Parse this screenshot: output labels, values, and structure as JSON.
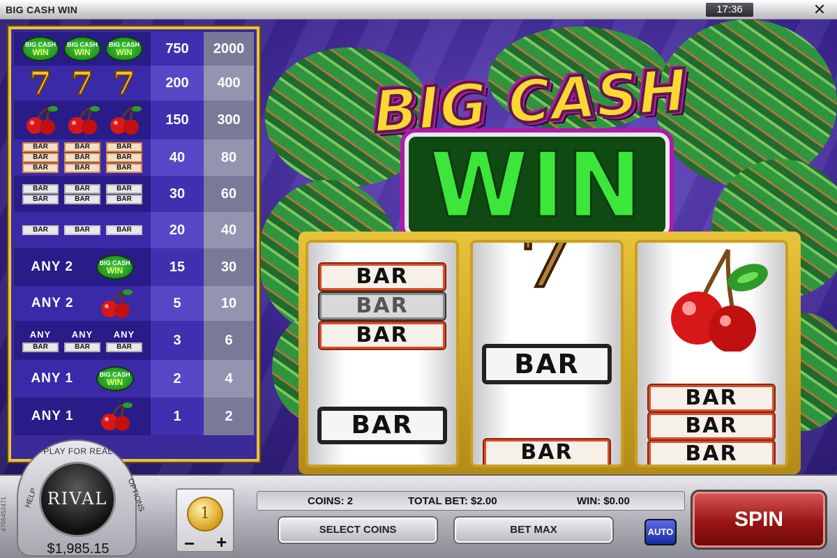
{
  "window": {
    "title": "BIG CASH WIN",
    "clock": "17:36",
    "close_symbol": "✕"
  },
  "logo": {
    "line1": "BIG CASH",
    "line2": "WIN"
  },
  "paytable": {
    "rows": [
      {
        "symbols": "3 Big Cash Win logos",
        "pay1": "750",
        "pay2": "2000"
      },
      {
        "symbols": "3 Sevens",
        "pay1": "200",
        "pay2": "400"
      },
      {
        "symbols": "3 Cherries",
        "pay1": "150",
        "pay2": "300"
      },
      {
        "symbols": "3 Triple Bars",
        "pay1": "40",
        "pay2": "80"
      },
      {
        "symbols": "3 Double Bars",
        "pay1": "30",
        "pay2": "60"
      },
      {
        "symbols": "3 Single Bars",
        "pay1": "20",
        "pay2": "40"
      },
      {
        "any_label": "ANY 2",
        "symbols": "Big Cash Win logo",
        "pay1": "15",
        "pay2": "30"
      },
      {
        "any_label": "ANY 2",
        "symbols": "Cherry",
        "pay1": "5",
        "pay2": "10"
      },
      {
        "any_label": "ANY",
        "symbols": "Any Bars",
        "pay1": "3",
        "pay2": "6"
      },
      {
        "any_label": "ANY 1",
        "symbols": "Big Cash Win logo",
        "pay1": "2",
        "pay2": "4"
      },
      {
        "any_label": "ANY 1",
        "symbols": "Cherry",
        "pay1": "1",
        "pay2": "2"
      }
    ],
    "bar_text": "BAR",
    "seven_text": "7",
    "mini_logo_text": "BIG CASH",
    "mini_logo_win": "WIN"
  },
  "reels": {
    "bar_text": "BAR",
    "reel1": [
      "triple-bar",
      "single-bar"
    ],
    "reel2": [
      "seven-partial",
      "single-bar",
      "single-bar-partial"
    ],
    "reel3": [
      "cherry",
      "triple-bar"
    ]
  },
  "badge": {
    "play_for_real": "PLAY FOR REAL",
    "brand": "RIVAL",
    "help": "HELP",
    "options": "OPTIONS",
    "balance": "$1,985.15"
  },
  "coin": {
    "value": "1",
    "minus": "−",
    "plus": "+"
  },
  "info": {
    "coins": "COINS: 2",
    "total_bet": "TOTAL BET: $2.00",
    "win": "WIN: $0.00"
  },
  "buttons": {
    "select_coins": "SELECT COINS",
    "bet_max": "BET MAX",
    "auto": "AUTO",
    "spin": "SPIN"
  },
  "side_id": "4756452471"
}
